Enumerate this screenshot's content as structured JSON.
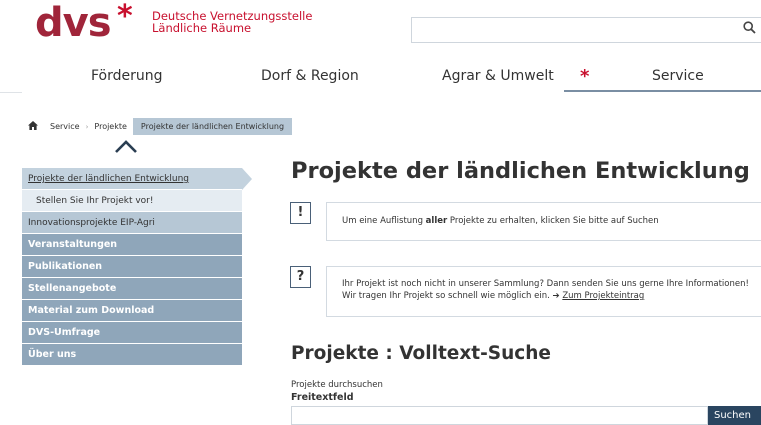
{
  "logo": {
    "wordmark": "dvs",
    "star": "*",
    "line1": "Deutsche Vernetzungsstelle",
    "line2": "Ländliche Räume"
  },
  "search": {
    "placeholder": "",
    "icon": "search-icon"
  },
  "nav": {
    "items": [
      "Förderung",
      "Dorf & Region",
      "Agrar & Umwelt",
      "Service"
    ],
    "active": "Service",
    "active_marker": "*"
  },
  "breadcrumb": {
    "home_icon": "home-icon",
    "items": [
      "Service",
      "Projekte"
    ],
    "current": "Projekte der ländlichen Entwicklung"
  },
  "sidebar": {
    "collapse_icon": "chevron-up-icon",
    "items": [
      {
        "label": "Projekte der ländlichen Entwicklung",
        "state": "active"
      },
      {
        "label": "Stellen Sie Ihr Projekt vor!",
        "state": "sub"
      },
      {
        "label": "Innovationsprojekte EIP-Agri",
        "state": "light"
      },
      {
        "label": "Veranstaltungen",
        "state": "dark"
      },
      {
        "label": "Publikationen",
        "state": "dark"
      },
      {
        "label": "Stellenangebote",
        "state": "dark"
      },
      {
        "label": "Material zum Download",
        "state": "dark"
      },
      {
        "label": "DVS-Umfrage",
        "state": "dark"
      },
      {
        "label": "Über uns",
        "state": "dark"
      }
    ]
  },
  "main": {
    "title": "Projekte der ländlichen Entwicklung",
    "notice1": {
      "icon": "!",
      "before": "Um eine Auflistung ",
      "bold": "aller",
      "after": " Projekte zu erhalten, klicken Sie bitte auf Suchen"
    },
    "notice2": {
      "icon": "?",
      "line1": "Ihr Projekt ist noch nicht in unserer Sammlung? Dann senden Sie uns gerne Ihre Informationen!",
      "line2_before": "Wir tragen Ihr Projekt so schnell wie möglich ein. ",
      "arrow": "➔",
      "link": "Zum Projekteintrag"
    },
    "search_section": {
      "title": "Projekte : Volltext-Suche",
      "hint": "Projekte durchsuchen",
      "field_label": "Freitextfeld",
      "input_value": "",
      "button": "Suchen"
    }
  },
  "colors": {
    "brand_red": "#c8102e",
    "logo_maroon": "#a0253a",
    "sidebar_dark": "#8fa6ba",
    "sidebar_light": "#b6c7d5",
    "button": "#2a4560"
  }
}
